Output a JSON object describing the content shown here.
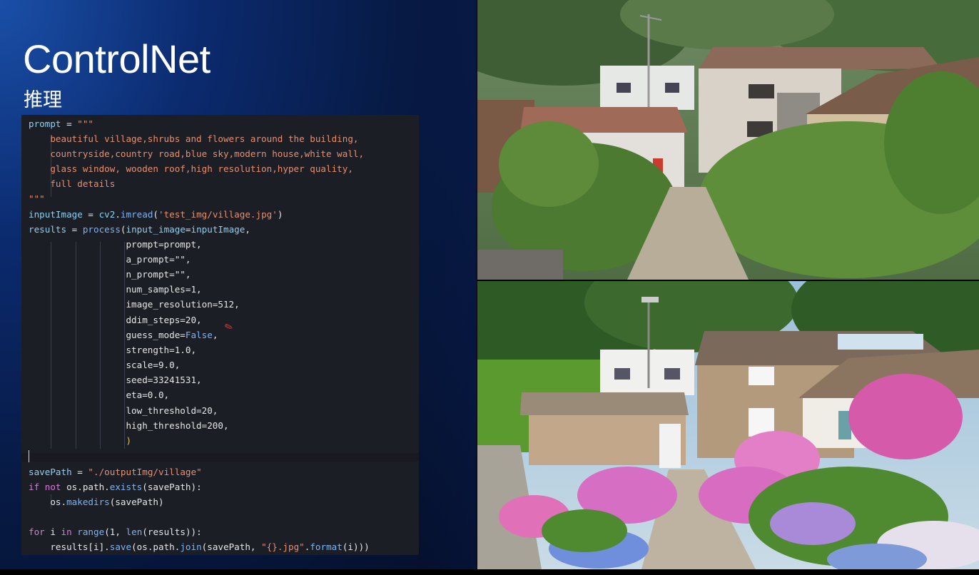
{
  "slide": {
    "title": "ControlNet",
    "subtitle": "推理"
  },
  "code": {
    "lines": [
      "prompt = \"\"\"",
      "    beautiful village,shrubs and flowers around the building,",
      "    countryside,country road,blue sky,modern house,white wall,",
      "    glass window, wooden roof,high resolution,hyper quality,",
      "    full details",
      "\"\"\"",
      "inputImage = cv2.imread('test_img/village.jpg')",
      "results = process(input_image=inputImage,",
      "                  prompt=prompt,",
      "                  a_prompt=\"\",",
      "                  n_prompt=\"\",",
      "                  num_samples=1,",
      "                  image_resolution=512,",
      "                  ddim_steps=20,",
      "                  guess_mode=False,",
      "                  strength=1.0,",
      "                  scale=9.0,",
      "                  seed=33241531,",
      "                  eta=0.0,",
      "                  low_threshold=20,",
      "                  high_threshold=200,",
      "                  )",
      "savePath = \"./outputImg/village\"",
      "if not os.path.exists(savePath):",
      "    os.makedirs(savePath)",
      "for i in range(1, len(results)):",
      "    results[i].save(os.path.join(savePath, \"{}.jpg\".format(i)))"
    ]
  },
  "images": {
    "top": "input-village-photo",
    "bottom": "generated-village-photo"
  }
}
